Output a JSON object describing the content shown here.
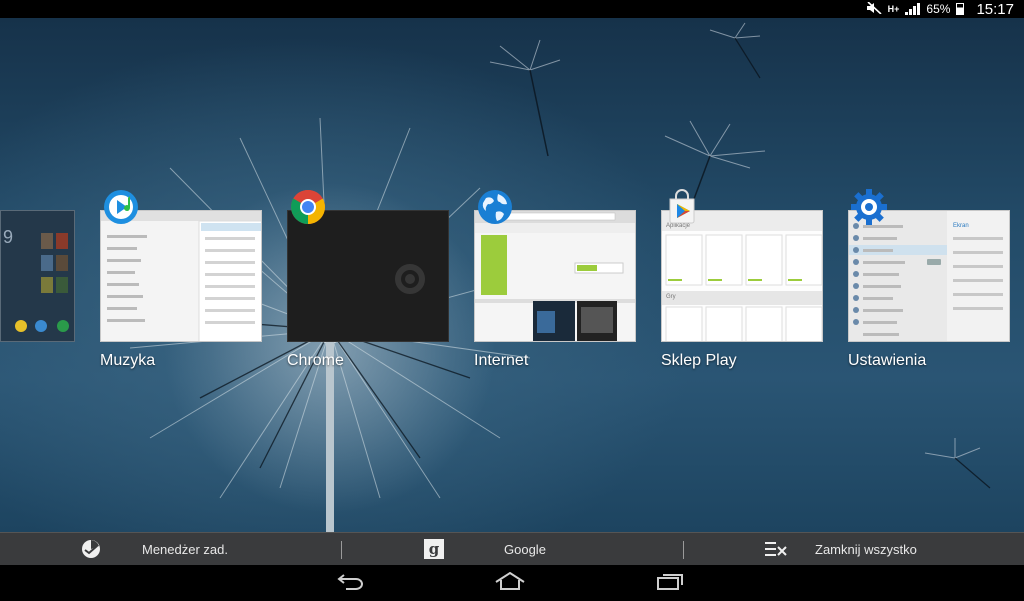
{
  "status_bar": {
    "network": "H+",
    "battery": "65%",
    "time": "15:17"
  },
  "icons": {
    "mute": "mute-icon",
    "signal": "signal-icon",
    "battery": "battery-icon"
  },
  "recent_apps": [
    {
      "label": "Muzyka",
      "icon": "music-icon"
    },
    {
      "label": "Chrome",
      "icon": "chrome-icon"
    },
    {
      "label": "Internet",
      "icon": "globe-icon"
    },
    {
      "label": "Sklep Play",
      "icon": "play-store-icon"
    },
    {
      "label": "Ustawienia",
      "icon": "settings-gear-icon"
    }
  ],
  "action_bar": {
    "task_manager": "Menedżer zad.",
    "google": "Google",
    "close_all": "Zamknij wszystko"
  },
  "thumb_text": {
    "play_apps": "Aplikacje",
    "play_games": "Gry",
    "settings_header": "Ekran"
  },
  "colors": {
    "wallpaper": "#234b68",
    "action_bar": "#3a3b3d",
    "play_accent": "#9ccc3c"
  }
}
